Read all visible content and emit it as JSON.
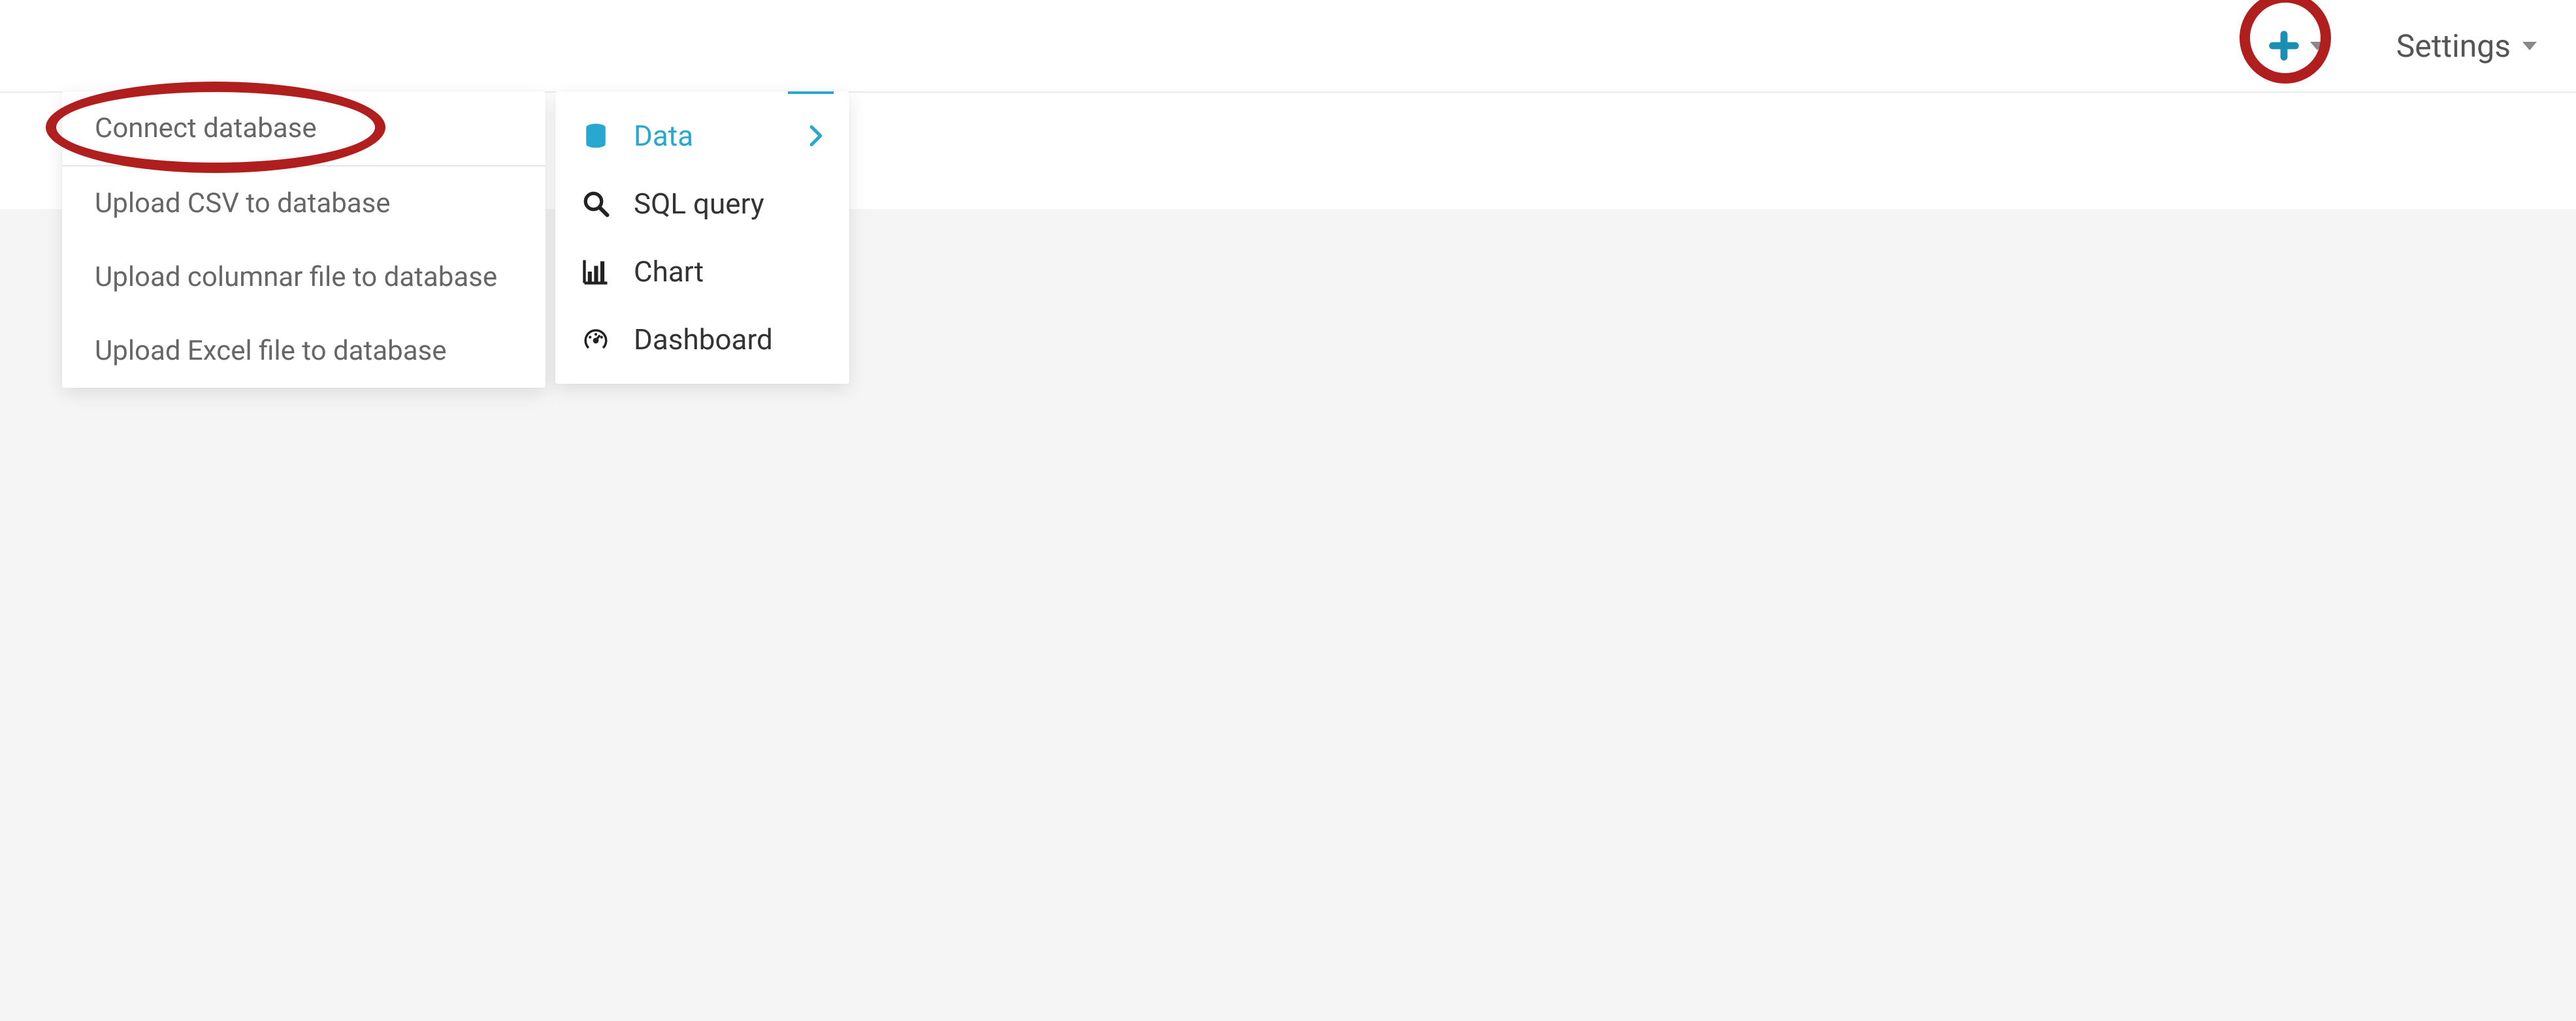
{
  "topbar": {
    "settings_label": "Settings"
  },
  "menu": {
    "items": [
      {
        "label": "Data",
        "active": true,
        "has_submenu": true
      },
      {
        "label": "SQL query"
      },
      {
        "label": "Chart"
      },
      {
        "label": "Dashboard"
      }
    ]
  },
  "submenu": {
    "items": [
      {
        "label": "Connect database"
      },
      {
        "label": "Upload CSV to database"
      },
      {
        "label": "Upload columnar file to database"
      },
      {
        "label": "Upload Excel file to database"
      }
    ]
  },
  "colors": {
    "accent": "#28A7CF",
    "highlight": "#B01E1E"
  }
}
